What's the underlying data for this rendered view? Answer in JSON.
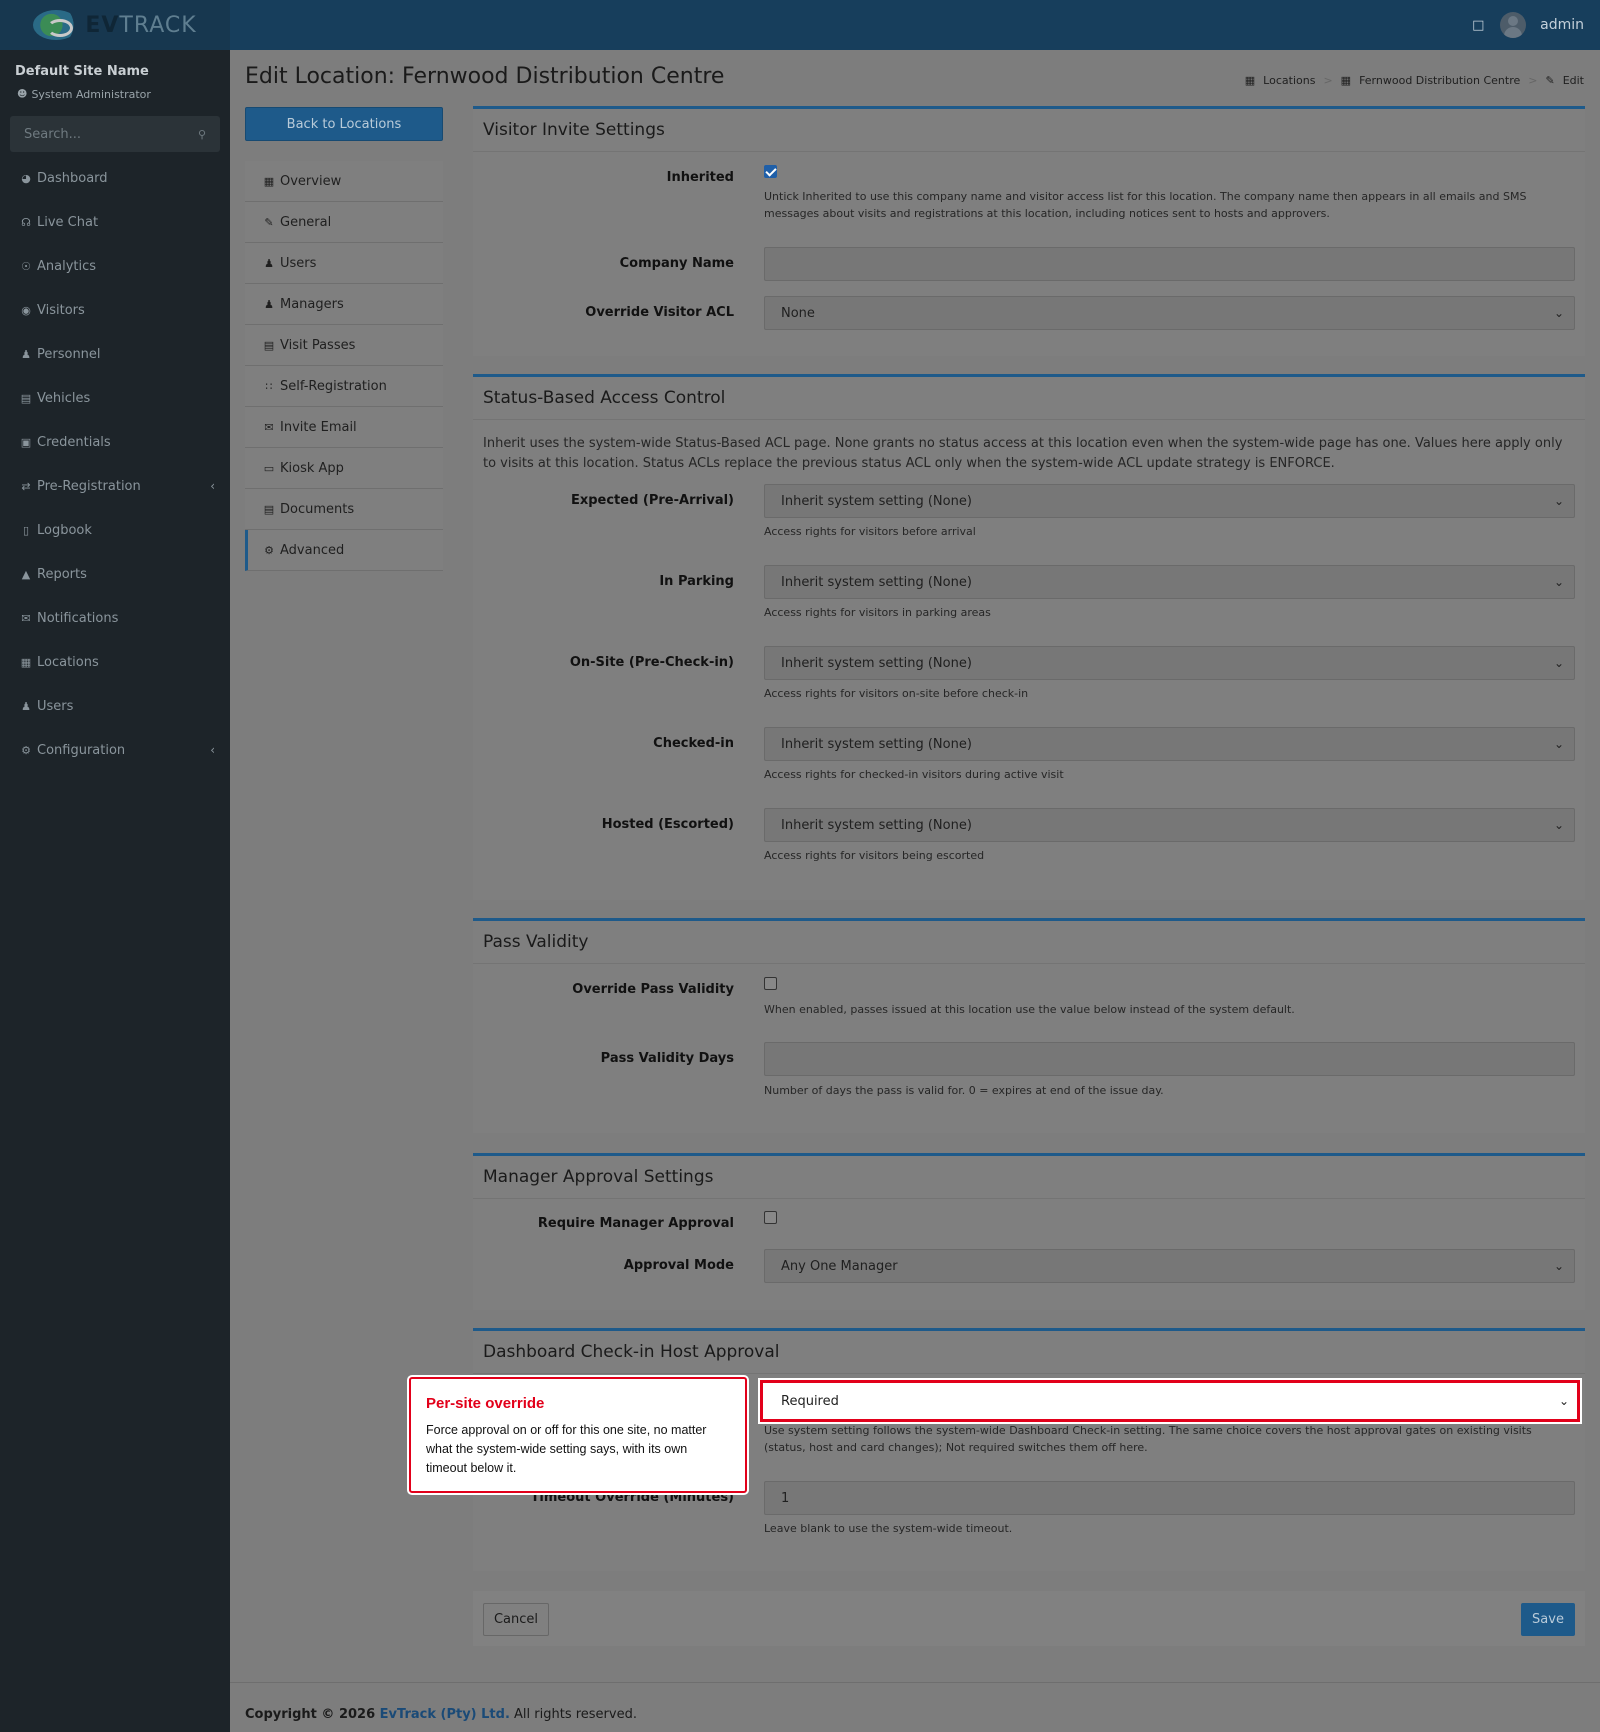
{
  "brand": {
    "name_strong": "EV",
    "name_light": "TRACK"
  },
  "topbar": {
    "user": "admin"
  },
  "sidebar": {
    "site_name": "Default Site Name",
    "site_role": "System Administrator",
    "search_placeholder": "Search...",
    "items": [
      {
        "label": "Dashboard",
        "icon": "dashboard-icon"
      },
      {
        "label": "Live Chat",
        "icon": "headset-icon"
      },
      {
        "label": "Analytics",
        "icon": "analytics-icon"
      },
      {
        "label": "Visitors",
        "icon": "eye-icon"
      },
      {
        "label": "Personnel",
        "icon": "personnel-icon"
      },
      {
        "label": "Vehicles",
        "icon": "car-icon"
      },
      {
        "label": "Credentials",
        "icon": "badge-icon"
      },
      {
        "label": "Pre-Registration",
        "icon": "arrows-icon"
      },
      {
        "label": "Logbook",
        "icon": "book-icon"
      },
      {
        "label": "Reports",
        "icon": "chart-icon"
      },
      {
        "label": "Notifications",
        "icon": "chat-icon"
      },
      {
        "label": "Locations",
        "icon": "map-icon"
      },
      {
        "label": "Users",
        "icon": "users-icon"
      },
      {
        "label": "Configuration",
        "icon": "gear-icon"
      }
    ]
  },
  "page": {
    "title": "Edit Location: Fernwood Distribution Centre",
    "breadcrumb": [
      "Locations",
      "Fernwood Distribution Centre",
      "Edit"
    ],
    "back_label": "Back to Locations"
  },
  "subnav": [
    "Overview",
    "General",
    "Users",
    "Managers",
    "Visit Passes",
    "Self-Registration",
    "Invite Email",
    "Kiosk App",
    "Documents",
    "Advanced"
  ],
  "visitor_invite": {
    "title": "Visitor Invite Settings",
    "inherited_label": "Inherited",
    "inherited_checked": true,
    "inherited_help": "Untick Inherited to use this company name and visitor access list for this location. The company name then appears in all emails and SMS messages about visits and registrations at this location, including notices sent to hosts and approvers.",
    "company_label": "Company Name",
    "company_value": "",
    "acl_label": "Override Visitor ACL",
    "acl_value": "None"
  },
  "status_acl": {
    "title": "Status-Based Access Control",
    "description": "Inherit uses the system-wide Status-Based ACL page. None grants no status access at this location even when the system-wide page has one. Values here apply only to visits at this location. Status ACLs replace the previous status ACL only when the system-wide ACL update strategy is ENFORCE.",
    "rows": [
      {
        "label": "Expected (Pre-Arrival)",
        "value": "Inherit system setting (None)",
        "help": "Access rights for visitors before arrival"
      },
      {
        "label": "In Parking",
        "value": "Inherit system setting (None)",
        "help": "Access rights for visitors in parking areas"
      },
      {
        "label": "On-Site (Pre-Check-in)",
        "value": "Inherit system setting (None)",
        "help": "Access rights for visitors on-site before check-in"
      },
      {
        "label": "Checked-in",
        "value": "Inherit system setting (None)",
        "help": "Access rights for checked-in visitors during active visit"
      },
      {
        "label": "Hosted (Escorted)",
        "value": "Inherit system setting (None)",
        "help": "Access rights for visitors being escorted"
      }
    ]
  },
  "pass_validity": {
    "title": "Pass Validity",
    "override_label": "Override Pass Validity",
    "override_help": "When enabled, passes issued at this location use the value below instead of the system default.",
    "days_label": "Pass Validity Days",
    "days_help": "Number of days the pass is valid for. 0 = expires at end of the issue day."
  },
  "manager_approval": {
    "title": "Manager Approval Settings",
    "require_label": "Require Manager Approval",
    "mode_label": "Approval Mode",
    "mode_value": "Any One Manager"
  },
  "host_approval": {
    "title": "Dashboard Check-in Host Approval",
    "value": "Required",
    "help": "Use system setting follows the system-wide Dashboard Check-in setting. The same choice covers the host approval gates on existing visits (status, host and card changes); Not required switches them off here.",
    "timeout_label": "Timeout Override (Minutes)",
    "timeout_value": "1",
    "timeout_help": "Leave blank to use the system-wide timeout."
  },
  "actions": {
    "cancel": "Cancel",
    "save": "Save"
  },
  "footer": {
    "prefix": "Copyright © 2026 ",
    "company": "EvTrack (Pty) Ltd.",
    "suffix": " All rights reserved."
  },
  "callout": {
    "title": "Per-site override",
    "body": "Force approval on or off for this one site, no matter what the system-wide setting says, with its own timeout below it."
  }
}
